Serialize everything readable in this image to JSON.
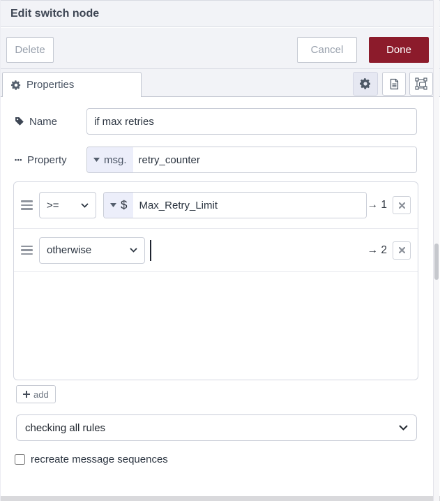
{
  "header": {
    "title": "Edit switch node"
  },
  "actions": {
    "delete": "Delete",
    "cancel": "Cancel",
    "done": "Done"
  },
  "tab": {
    "properties": "Properties"
  },
  "fields": {
    "name": {
      "label": "Name",
      "value": "if max retries"
    },
    "property": {
      "label": "Property",
      "prefix": "msg.",
      "value": "retry_counter"
    }
  },
  "rules": [
    {
      "operator": ">=",
      "type_symbol": "$",
      "value": "Max_Retry_Limit",
      "output": "→ 1"
    },
    {
      "operator": "otherwise",
      "output": "→ 2"
    }
  ],
  "rules_footer": {
    "add_label": "add"
  },
  "mode_select": {
    "value": "checking all rules"
  },
  "options": {
    "recreate_label": "recreate message sequences",
    "checked": false
  },
  "colors": {
    "accent_red": "#8C1B2B",
    "type_button_bg": "#ECEEFA",
    "header_bg": "#F2F3F7"
  }
}
